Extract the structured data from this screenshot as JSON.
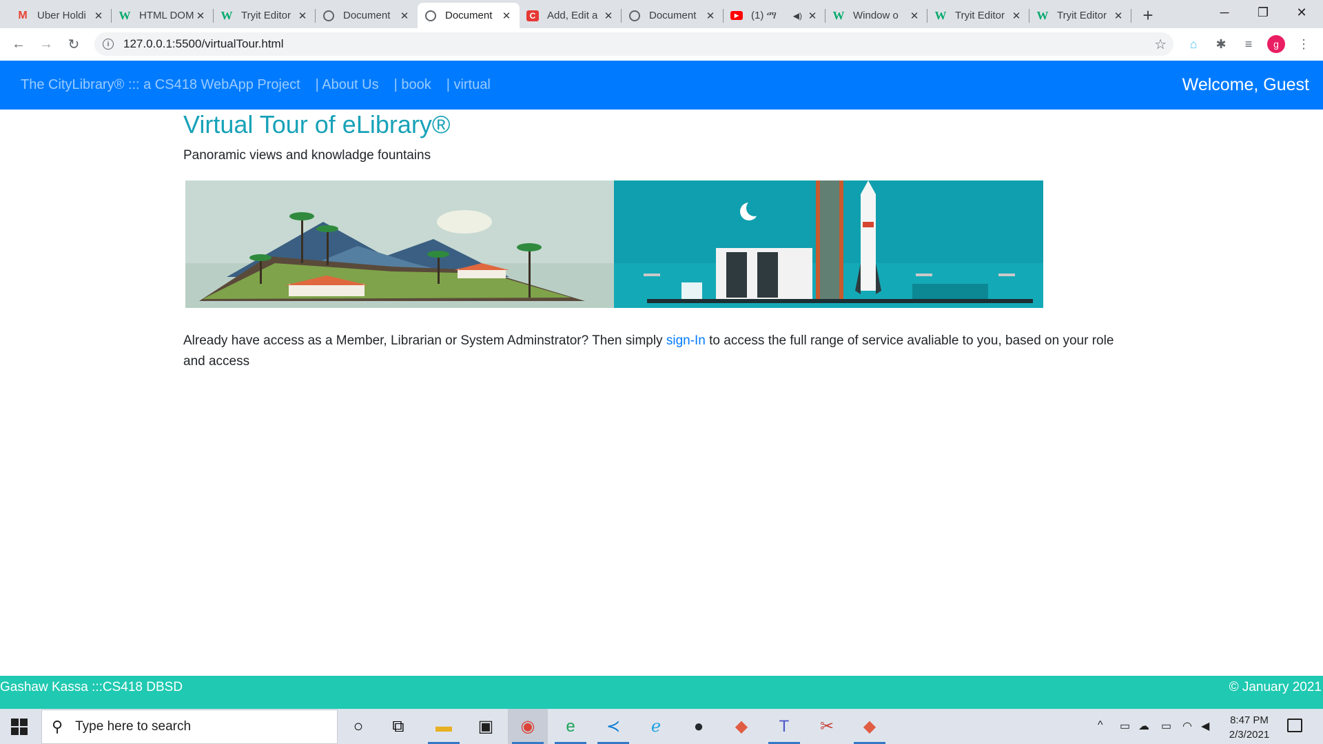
{
  "browser": {
    "tabs": [
      {
        "title": "Uber Holdi",
        "icon": "gmail-icon",
        "active": false
      },
      {
        "title": "HTML DOM",
        "icon": "w3schools-icon",
        "active": false
      },
      {
        "title": "Tryit Editor",
        "icon": "w3schools-icon",
        "active": false
      },
      {
        "title": "Document",
        "icon": "globe-icon",
        "active": false
      },
      {
        "title": "Document",
        "icon": "globe-icon",
        "active": true
      },
      {
        "title": "Add, Edit a",
        "icon": "red-c-icon",
        "active": false
      },
      {
        "title": "Document",
        "icon": "globe-icon",
        "active": false
      },
      {
        "title": "(1) ማ",
        "icon": "youtube-icon",
        "active": false
      },
      {
        "title": "Window o",
        "icon": "w3schools-icon",
        "active": false
      },
      {
        "title": "Tryit Editor",
        "icon": "w3schools-icon",
        "active": false
      },
      {
        "title": "Tryit Editor",
        "icon": "w3schools-icon",
        "active": false
      }
    ],
    "url": "127.0.0.1:5500/virtualTour.html",
    "profile_initial": "g"
  },
  "navbar": {
    "brand": "The CityLibrary® ::: a CS418 WebApp Project",
    "links": [
      "| About Us",
      "| book",
      "| virtual"
    ],
    "welcome": "Welcome, Guest"
  },
  "main": {
    "title": "Virtual Tour of eLibrary®",
    "subtitle": "Panoramic views and knowladge fountains",
    "paragraph_before": "Already have access as a Member, Librarian or System Adminstrator? Then simply ",
    "signin_link": "sign-In",
    "paragraph_after": " to access the full range of service avaliable to you, based on your role and access"
  },
  "footer": {
    "left": "Gashaw Kassa :::CS418 DBSD",
    "right": "© January 2021"
  },
  "taskbar": {
    "search_placeholder": "Type here to search",
    "time": "8:47 PM",
    "date": "2/3/2021"
  },
  "colors": {
    "navbar": "#007bff",
    "title": "#17a2b8",
    "footer": "#20c9b1",
    "link": "#007bff"
  }
}
